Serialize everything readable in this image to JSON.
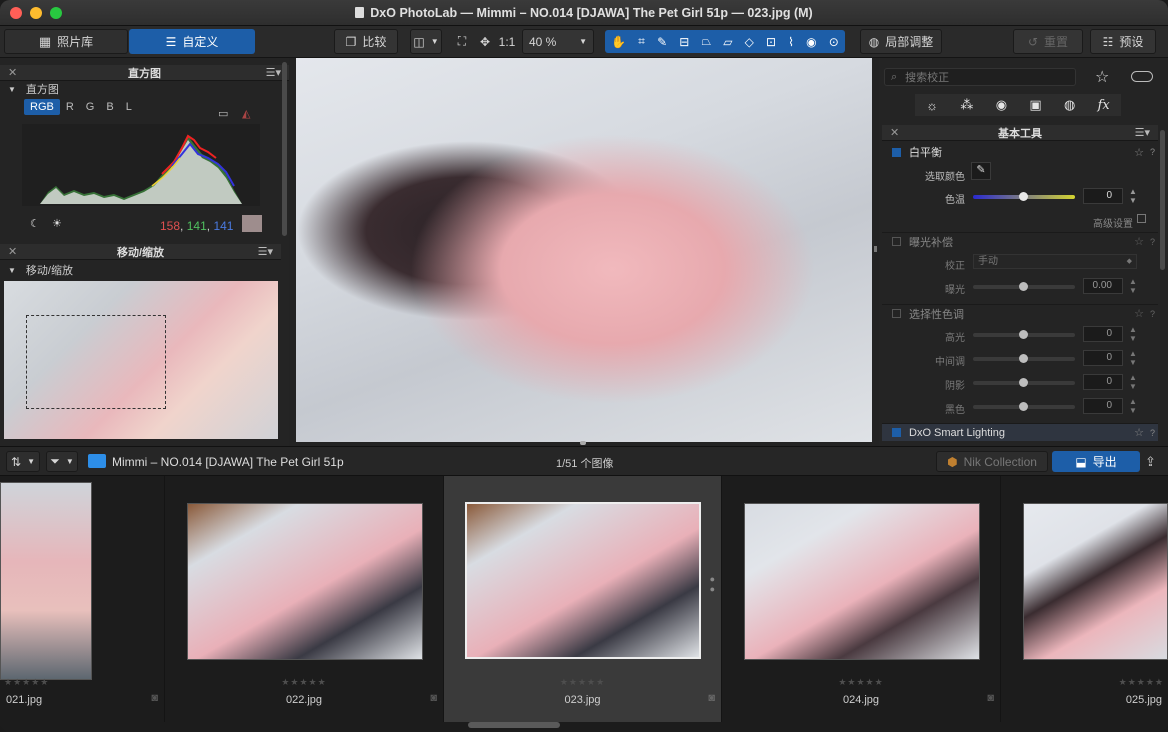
{
  "window": {
    "title": "DxO PhotoLab — Mimmi – NO.014 [DJAWA] The Pet Girl 51p — 023.jpg (M)"
  },
  "toolbar": {
    "library_tab": "照片库",
    "customize_tab": "自定义",
    "compare": "比较",
    "zoom_label": "1:1",
    "zoom_value": "40 %",
    "local_adjust": "局部调整",
    "reset": "重置",
    "presets": "预设"
  },
  "left": {
    "histogram_panel": "直方图",
    "histogram_sub": "直方图",
    "channels": [
      "RGB",
      "R",
      "G",
      "B",
      "L"
    ],
    "rgb_r": "158",
    "rgb_g": "141",
    "rgb_b": "141",
    "sep": ",",
    "move_panel": "移动/缩放",
    "move_sub": "移动/缩放"
  },
  "right": {
    "search_placeholder": "搜索校正",
    "basic_tools": "基本工具",
    "white_balance": "白平衡",
    "pick_color": "选取颜色",
    "temperature": "色温",
    "temperature_value": "0",
    "advanced": "高级设置",
    "exposure_comp": "曝光补偿",
    "correction": "校正",
    "correction_value": "手动",
    "exposure": "曝光",
    "exposure_value": "0.00",
    "selective_tone": "选择性色调",
    "highlights": "高光",
    "highlights_value": "0",
    "midtones": "中间调",
    "midtones_value": "0",
    "shadows": "阴影",
    "shadows_value": "0",
    "blacks": "黑色",
    "blacks_value": "0",
    "smart_lighting": "DxO Smart Lighting"
  },
  "bottom": {
    "folder": "Mimmi – NO.014 [DJAWA] The Pet Girl 51p",
    "count": "1/51 个图像",
    "nik": "Nik Collection",
    "export": "导出"
  },
  "filmstrip": [
    {
      "name": "021.jpg"
    },
    {
      "name": "022.jpg"
    },
    {
      "name": "023.jpg"
    },
    {
      "name": "024.jpg"
    },
    {
      "name": "025.jpg"
    }
  ],
  "colors": {
    "accent": "#1d5ea8",
    "bg": "#232323"
  }
}
